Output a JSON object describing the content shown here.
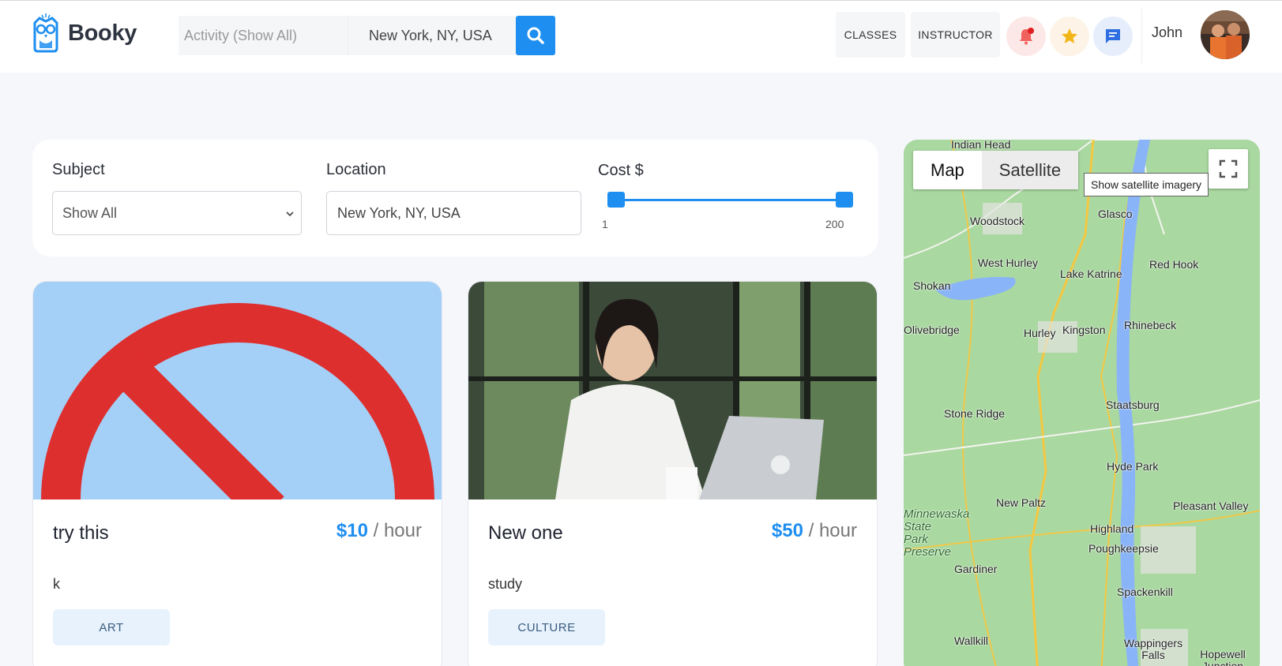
{
  "header": {
    "logo_text": "Booky",
    "search": {
      "activity_placeholder": "Activity (Show All)",
      "location_value": "New York, NY, USA"
    },
    "nav": {
      "classes": "CLASSES",
      "instructor": "INSTRUCTOR"
    },
    "icons": {
      "search": "search-icon",
      "bell": "bell-icon",
      "star": "star-icon",
      "chat": "chat-icon"
    },
    "user_name": "John"
  },
  "filter": {
    "subject_label": "Subject",
    "subject_value": "Show All",
    "location_label": "Location",
    "location_value": "New York, NY, USA",
    "cost_label": "Cost $",
    "cost_min": "1",
    "cost_max": "200"
  },
  "cards": [
    {
      "title": "try this",
      "price": "$10",
      "unit": "/  hour",
      "description": "k",
      "tag": "ART"
    },
    {
      "title": "New one",
      "price": "$50",
      "unit": "/  hour",
      "description": "study",
      "tag": "CULTURE"
    }
  ],
  "map": {
    "tab_map": "Map",
    "tab_satellite": "Satellite",
    "tooltip": "Show satellite imagery",
    "labels": [
      "Indian Head",
      "Woodstock",
      "Glasco",
      "West Hurley",
      "Lake Katrine",
      "Red Hook",
      "Shokan",
      "Olivebridge",
      "Hurley",
      "Kingston",
      "Rhinebeck",
      "Stone Ridge",
      "Staatsburg",
      "Hyde Park",
      "New Paltz",
      "Pleasant Valley",
      "Highland",
      "Poughkeepsie",
      "Gardiner",
      "Spackenkill",
      "Wallkill",
      "Wappingers Falls",
      "Hopewell Junction",
      "Minnewaska State Park Preserve"
    ]
  },
  "colors": {
    "accent": "#1e8ef0",
    "bell_bg": "#fde8e8",
    "star_bg": "#fdf3e6",
    "chat_bg": "#e6eefc"
  }
}
